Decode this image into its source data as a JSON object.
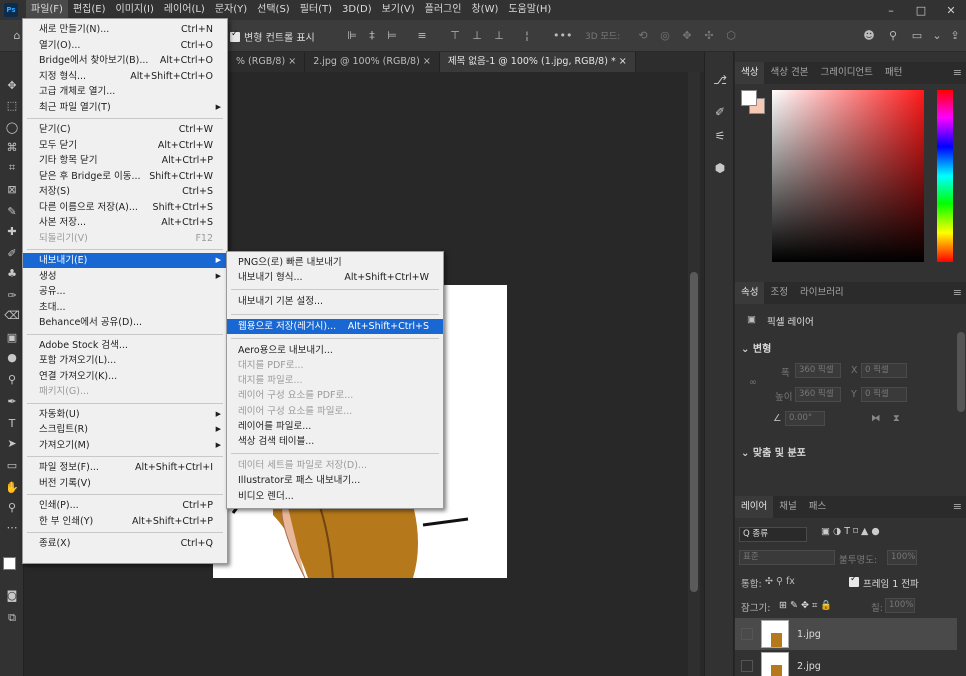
{
  "menubar": {
    "logo": "Ps",
    "items": [
      "파일(F)",
      "편집(E)",
      "이미지(I)",
      "레이어(L)",
      "문자(Y)",
      "선택(S)",
      "필터(T)",
      "3D(D)",
      "보기(V)",
      "플러그인",
      "창(W)",
      "도움말(H)"
    ],
    "window_controls": [
      "–",
      "□",
      "✕"
    ]
  },
  "options_bar": {
    "transform_controls_label": "변형 컨트롤 표시",
    "mode_3d": "3D 모드:",
    "more": "•••"
  },
  "document_tabs": [
    {
      "label": "% (RGB/8)",
      "close": "×",
      "active": false
    },
    {
      "label": "2.jpg @ 100% (RGB/8)",
      "close": "×",
      "active": false
    },
    {
      "label": "제목 없음-1 @ 100% (1.jpg, RGB/8) *",
      "close": "×",
      "active": true
    }
  ],
  "file_menu": {
    "items": [
      {
        "label": "새로 만들기(N)...",
        "shortcut": "Ctrl+N"
      },
      {
        "label": "열기(O)...",
        "shortcut": "Ctrl+O"
      },
      {
        "label": "Bridge에서 찾아보기(B)...",
        "shortcut": "Alt+Ctrl+O"
      },
      {
        "label": "지정 형식...",
        "shortcut": "Alt+Shift+Ctrl+O"
      },
      {
        "label": "고급 개체로 열기...",
        "shortcut": ""
      },
      {
        "label": "최근 파일 열기(T)",
        "shortcut": "",
        "submenu": true
      },
      {
        "sep": true
      },
      {
        "label": "닫기(C)",
        "shortcut": "Ctrl+W"
      },
      {
        "label": "모두 닫기",
        "shortcut": "Alt+Ctrl+W"
      },
      {
        "label": "기타 항목 닫기",
        "shortcut": "Alt+Ctrl+P"
      },
      {
        "label": "닫은 후 Bridge로 이동...",
        "shortcut": "Shift+Ctrl+W"
      },
      {
        "label": "저장(S)",
        "shortcut": "Ctrl+S"
      },
      {
        "label": "다른 이름으로 저장(A)...",
        "shortcut": "Shift+Ctrl+S"
      },
      {
        "label": "사본 저장...",
        "shortcut": "Alt+Ctrl+S"
      },
      {
        "label": "되돌리기(V)",
        "shortcut": "F12",
        "disabled": true
      },
      {
        "sep": true
      },
      {
        "label": "내보내기(E)",
        "shortcut": "",
        "submenu": true,
        "highlighted": true
      },
      {
        "label": "생성",
        "shortcut": "",
        "submenu": true
      },
      {
        "label": "공유...",
        "shortcut": ""
      },
      {
        "label": "초대...",
        "shortcut": ""
      },
      {
        "label": "Behance에서 공유(D)...",
        "shortcut": ""
      },
      {
        "sep": true
      },
      {
        "label": "Adobe Stock 검색...",
        "shortcut": ""
      },
      {
        "label": "포함 가져오기(L)...",
        "shortcut": ""
      },
      {
        "label": "연결 가져오기(K)...",
        "shortcut": ""
      },
      {
        "label": "패키지(G)...",
        "shortcut": "",
        "disabled": true
      },
      {
        "sep": true
      },
      {
        "label": "자동화(U)",
        "shortcut": "",
        "submenu": true
      },
      {
        "label": "스크립트(R)",
        "shortcut": "",
        "submenu": true
      },
      {
        "label": "가져오기(M)",
        "shortcut": "",
        "submenu": true
      },
      {
        "sep": true
      },
      {
        "label": "파일 정보(F)...",
        "shortcut": "Alt+Shift+Ctrl+I"
      },
      {
        "label": "버전 기록(V)",
        "shortcut": ""
      },
      {
        "sep": true
      },
      {
        "label": "인쇄(P)...",
        "shortcut": "Ctrl+P"
      },
      {
        "label": "한 부 인쇄(Y)",
        "shortcut": "Alt+Shift+Ctrl+P"
      },
      {
        "sep": true
      },
      {
        "label": "종료(X)",
        "shortcut": "Ctrl+Q"
      }
    ]
  },
  "export_submenu": {
    "items": [
      {
        "label": "PNG으(로) 빠른 내보내기",
        "shortcut": ""
      },
      {
        "label": "내보내기 형식...",
        "shortcut": "Alt+Shift+Ctrl+W"
      },
      {
        "sep": true
      },
      {
        "label": "내보내기 기본 설정...",
        "shortcut": ""
      },
      {
        "sep": true
      },
      {
        "label": "웹용으로 저장(레거시)...",
        "shortcut": "Alt+Shift+Ctrl+S",
        "highlighted": true
      },
      {
        "sep": true
      },
      {
        "label": "Aero용으로 내보내기...",
        "shortcut": ""
      },
      {
        "label": "대지를 PDF로...",
        "shortcut": "",
        "disabled": true
      },
      {
        "label": "대지를 파일로...",
        "shortcut": "",
        "disabled": true
      },
      {
        "label": "레이어 구성 요소를 PDF로...",
        "shortcut": "",
        "disabled": true
      },
      {
        "label": "레이어 구성 요소를 파일로...",
        "shortcut": "",
        "disabled": true
      },
      {
        "label": "레이어를 파일로...",
        "shortcut": ""
      },
      {
        "label": "색상 검색 테이블...",
        "shortcut": ""
      },
      {
        "sep": true
      },
      {
        "label": "데이터 세트를 파일로 저장(D)...",
        "shortcut": "",
        "disabled": true
      },
      {
        "label": "Illustrator로 패스 내보내기...",
        "shortcut": ""
      },
      {
        "label": "비디오 렌더...",
        "shortcut": ""
      }
    ]
  },
  "color_panel": {
    "tabs": [
      "색상",
      "색상 견본",
      "그레이디언트",
      "패턴"
    ],
    "foreground": "#ffffff",
    "background": "#f7c9b4"
  },
  "properties_panel": {
    "tabs": [
      "속성",
      "조정",
      "라이브러리"
    ],
    "layer_type": "픽셀 레이어",
    "transform_head": "변형",
    "width_label": "폭",
    "width_value": "360 픽셀",
    "height_label": "높이",
    "height_value": "360 픽셀",
    "x_label": "X",
    "x_value": "0 픽셀",
    "y_label": "Y",
    "y_value": "0 픽셀",
    "angle_value": "0.00°",
    "align_head": "맞춤 및 분포"
  },
  "layers_panel": {
    "tabs": [
      "레이어",
      "채널",
      "패스"
    ],
    "filter_label": "Q 종류",
    "blend_mode": "표준",
    "opacity_label": "불투명도:",
    "opacity_value": "100%",
    "unify_label": "통합:",
    "propagate_label": "프레임 1 전파",
    "lock_label": "잠그기:",
    "fill_label": "칠:",
    "fill_value": "100%",
    "layers": [
      {
        "name": "1.jpg",
        "selected": true
      },
      {
        "name": "2.jpg",
        "selected": false
      }
    ]
  }
}
